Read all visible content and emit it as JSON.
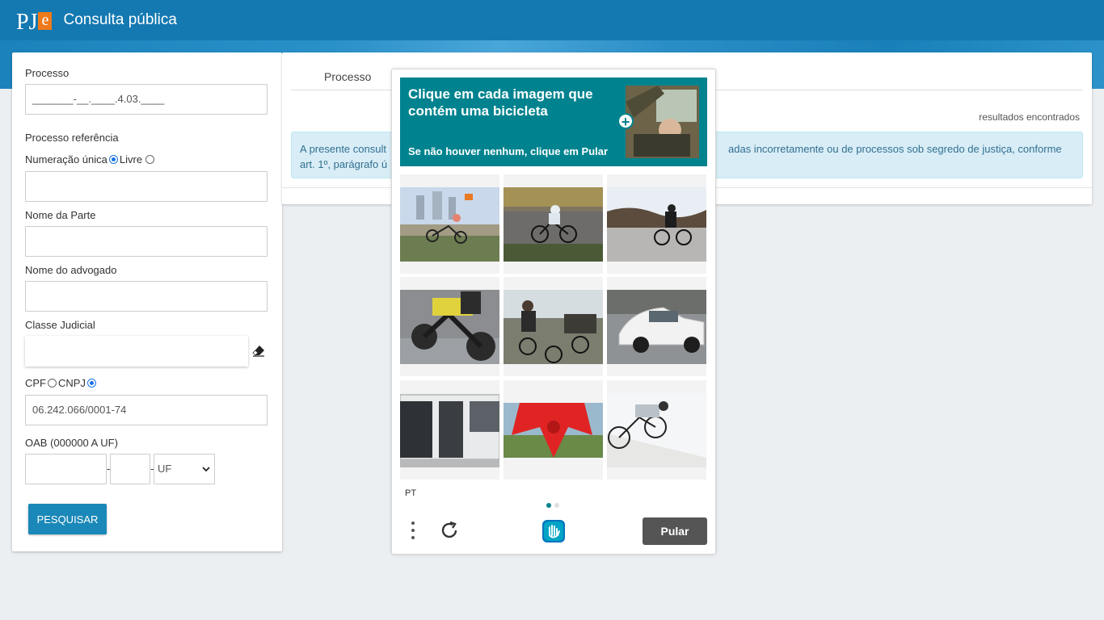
{
  "header": {
    "logo_main": "PJ",
    "logo_e": "e",
    "title": "Consulta pública"
  },
  "form": {
    "processo_label": "Processo",
    "processo_value": "_______-__.____.4.03.____",
    "processo_ref_label": "Processo referência",
    "numeracao_unica_label": "Numeração única",
    "livre_label": "Livre",
    "processo_ref_value": "",
    "nome_parte_label": "Nome da Parte",
    "nome_parte_value": "",
    "nome_advogado_label": "Nome do advogado",
    "nome_advogado_value": "",
    "classe_label": "Classe Judicial",
    "classe_value": "",
    "cpf_label": "CPF",
    "cnpj_label": "CNPJ",
    "doc_value": "06.242.066/0001-74",
    "oab_label": "OAB (000000 A UF)",
    "oab_sep1": "-",
    "oab_sep2": "-",
    "uf_selected": "UF",
    "search_button": "PESQUISAR"
  },
  "results": {
    "tab_processo": "Processo",
    "count_text": "resultados encontrados",
    "info_left": "A presente consult art. 1º, parágrafo ú",
    "info_right": "adas incorretamente ou de processos sob segredo de justiça, conforme"
  },
  "captcha": {
    "prompt": "Clique em cada imagem que contém uma bicicleta",
    "hint": "Se não houver nenhum, clique em Pular",
    "language": "PT",
    "skip_button": "Pular",
    "tiles": [
      {
        "name": "recumbent-trike-city"
      },
      {
        "name": "cyclist-road"
      },
      {
        "name": "recumbent-bike-road"
      },
      {
        "name": "motorcycle-yellow"
      },
      {
        "name": "cyclists-group"
      },
      {
        "name": "white-car"
      },
      {
        "name": "bus"
      },
      {
        "name": "red-costume"
      },
      {
        "name": "recumbent-bike-white"
      }
    ],
    "colors": {
      "header": "#00838f",
      "skip": "#555555"
    }
  },
  "colors": {
    "topbar": "#1479b1",
    "search_button": "#1a88b8"
  }
}
